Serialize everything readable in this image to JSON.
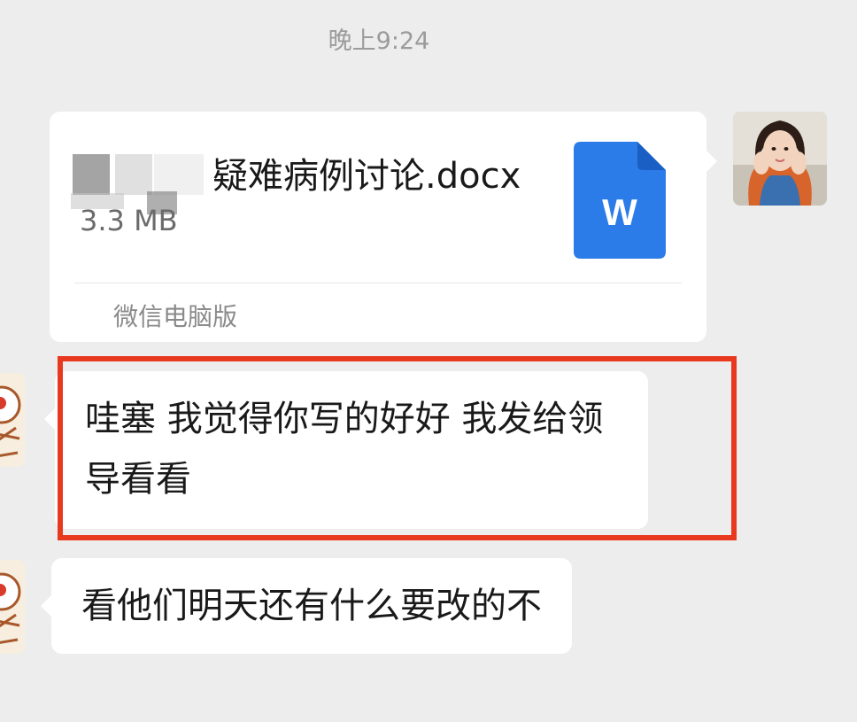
{
  "timestamp": "晚上9:24",
  "file_message": {
    "file_name": "疑难病例讨论.docx",
    "file_size": "3.3 MB",
    "file_type_letter": "W",
    "file_icon_color": "#2b7ce9",
    "source_label": "微信电脑版"
  },
  "messages": [
    {
      "lines": [
        "哇塞  我觉得你写的好好  我发给领",
        "导看看"
      ]
    },
    {
      "lines": [
        "看他们明天还有什么要改的不"
      ]
    }
  ],
  "highlight_color": "#e8391f"
}
